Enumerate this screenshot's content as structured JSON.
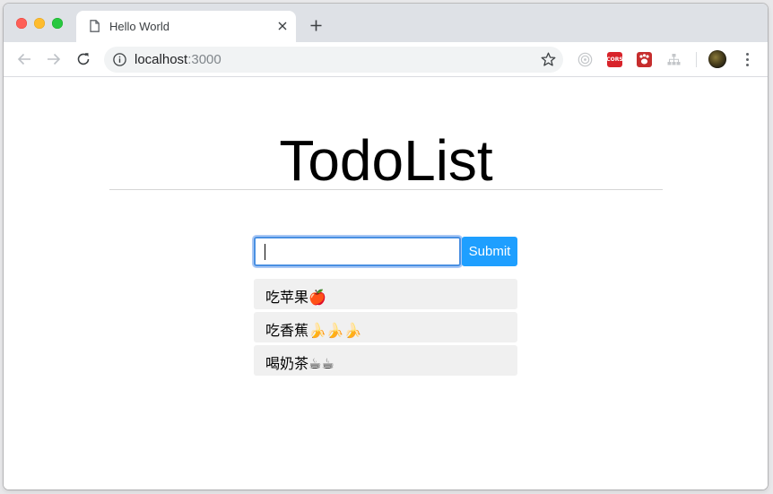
{
  "browser": {
    "tab": {
      "title": "Hello World",
      "icon": "document-icon"
    },
    "new_tab_icon": "plus-icon",
    "toolbar": {
      "url_host": "localhost",
      "url_port": ":3000",
      "extensions": [
        "radar-icon",
        "cors-icon",
        "paw-icon",
        "sitemap-icon"
      ],
      "cors_label": "CORS"
    }
  },
  "app": {
    "title": "TodoList",
    "input": {
      "value": "",
      "placeholder": ""
    },
    "submit_label": "Submit",
    "items": [
      {
        "text": "吃苹果🍎"
      },
      {
        "text": "吃香蕉🍌🍌🍌"
      },
      {
        "text": "喝奶茶☕☕"
      }
    ]
  },
  "colors": {
    "accent": "#1e9fff",
    "focus_ring": "#4a90e2",
    "item_background": "#f0f0f0"
  }
}
